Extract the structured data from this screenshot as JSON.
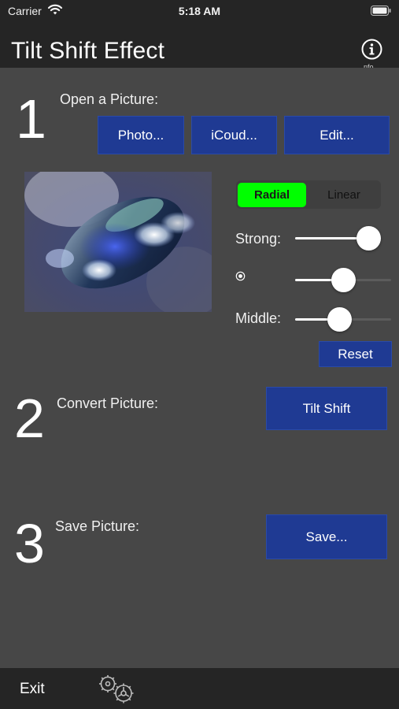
{
  "status_bar": {
    "carrier": "Carrier",
    "time": "5:18 AM"
  },
  "nav": {
    "title": "Tilt Shift Effect",
    "info_icon": "info-circle-icon",
    "info_caption": "nfo"
  },
  "step1": {
    "number": "1",
    "label": "Open a Picture:",
    "buttons": {
      "photo": "Photo...",
      "icloud": "iCoud...",
      "edit": "Edit..."
    }
  },
  "controls": {
    "mode": {
      "options": [
        "Radial",
        "Linear"
      ],
      "selected": "Radial",
      "selected_color": "#00ff00"
    },
    "strong_label": "Strong:",
    "middle_label": "Middle:",
    "position_icon": "radio-target-icon",
    "sliders": {
      "strong": 1.0,
      "position": 0.5,
      "middle": 0.46
    },
    "reset_label": "Reset"
  },
  "step2": {
    "number": "2",
    "label": "Convert Picture:",
    "button": "Tilt Shift"
  },
  "step3": {
    "number": "3",
    "label": "Save Picture:",
    "button": "Save..."
  },
  "toolbar": {
    "exit_label": "Exit",
    "settings_icon": "gears-icon"
  },
  "colors": {
    "background": "#474747",
    "bars": "#252525",
    "button": "#1f3a93",
    "segment_active": "#00ff00"
  }
}
